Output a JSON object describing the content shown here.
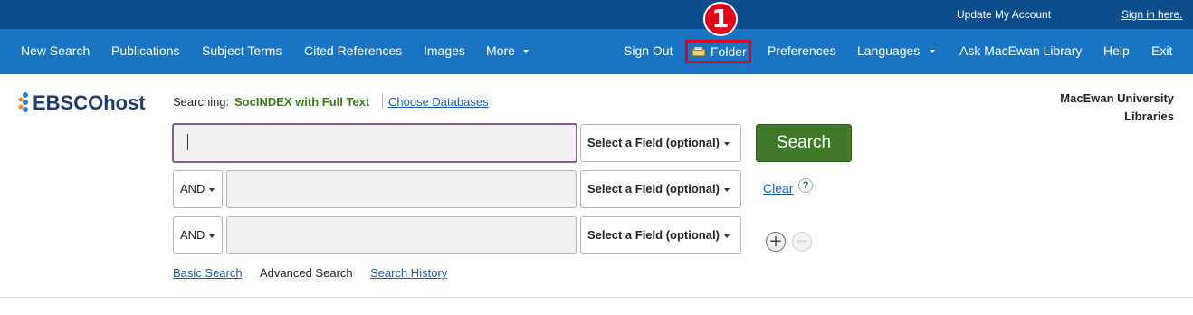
{
  "topbar": {
    "update_account": "Update My Account",
    "sign_in": "Sign in here."
  },
  "nav": {
    "left": [
      "New Search",
      "Publications",
      "Subject Terms",
      "Cited References",
      "Images"
    ],
    "more": "More",
    "sign_out": "Sign Out",
    "folder": "Folder",
    "preferences": "Preferences",
    "languages": "Languages",
    "ask": "Ask MacEwan Library",
    "help": "Help",
    "exit": "Exit"
  },
  "annotation": {
    "badge": "1",
    "highlight_color": "#e3001b"
  },
  "logo": {
    "text": "EBSCOhost"
  },
  "searching": {
    "label": "Searching:",
    "database": "SocINDEX with Full Text",
    "choose": "Choose Databases"
  },
  "institution": {
    "line1": "MacEwan University",
    "line2": "Libraries"
  },
  "search_rows": [
    {
      "operator": null,
      "value": "",
      "field": "Select a Field (optional)"
    },
    {
      "operator": "AND",
      "value": "",
      "field": "Select a Field (optional)"
    },
    {
      "operator": "AND",
      "value": "",
      "field": "Select a Field (optional)"
    }
  ],
  "actions": {
    "search": "Search",
    "clear": "Clear",
    "help_icon": "?",
    "add_row": "+",
    "remove_row": "−"
  },
  "bottom_links": {
    "basic": "Basic Search",
    "advanced": "Advanced Search",
    "history": "Search History"
  },
  "colors": {
    "topbar": "#0d4d8c",
    "navbar": "#1a74c4",
    "search_button": "#3f7a2a",
    "database_text": "#3d7a1e",
    "link": "#1a5eb0"
  }
}
